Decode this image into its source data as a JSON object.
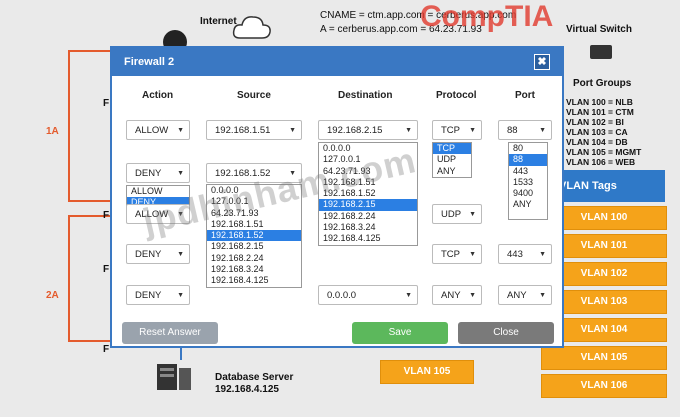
{
  "background": {
    "internet_label": "Internet",
    "cname_line": "CNAME = ctm.app.com = cerberus.app.com",
    "a_record_line": "A = cerberus.app.com = 64.23.71.93",
    "logo_text": "CompTIA",
    "virtual_switch_label": "Virtual Switch",
    "port_groups_label": "Port Groups",
    "vlans": [
      "VLAN 100 = NLB",
      "VLAN 101 = CTM",
      "VLAN 102 = BI",
      "VLAN 103 = CA",
      "VLAN 104 = DB",
      "VLAN 105 = MGMT",
      "VLAN 106 = WEB"
    ],
    "vlan_tags_label": "VLAN Tags",
    "vlan_tags": [
      "VLAN 100",
      "VLAN 101",
      "VLAN 102",
      "VLAN 103",
      "VLAN 104",
      "VLAN 105",
      "VLAN 106"
    ],
    "loose_tag": "VLAN 105",
    "zone_1a": "1A",
    "zone_2a": "2A",
    "f_labels": [
      "F",
      "F",
      "F",
      "F"
    ],
    "db_server_label": "Database Server",
    "db_server_ip": "192.168.4.125",
    "watermark": "jpdhinham.com"
  },
  "dialog": {
    "title": "Firewall 2",
    "close_glyph": "✖",
    "columns": [
      "Action",
      "Source",
      "Destination",
      "Protocol",
      "Port"
    ],
    "rows": [
      {
        "action": "ALLOW",
        "source": "192.168.1.51",
        "destination": "192.168.2.15",
        "protocol": "TCP",
        "port": "88"
      },
      {
        "action": "DENY",
        "source": "192.168.1.52",
        "destination": "",
        "protocol": "",
        "port": ""
      },
      {
        "action": "ALLOW",
        "source": "",
        "destination": "",
        "protocol": "UDP",
        "port": ""
      },
      {
        "action": "DENY",
        "source": "",
        "destination": "",
        "protocol": "TCP",
        "port": "443"
      },
      {
        "action": "DENY",
        "source": "",
        "destination": "0.0.0.0",
        "protocol": "ANY",
        "port": "ANY"
      }
    ],
    "action_options": [
      "ALLOW",
      "DENY"
    ],
    "action_selected": "DENY",
    "ip_options": [
      "0.0.0.0",
      "127.0.0.1",
      "64.23.71.93",
      "192.168.1.51",
      "192.168.1.52",
      "192.168.2.15",
      "192.168.2.24",
      "192.168.3.24",
      "192.168.4.125"
    ],
    "source_selected": "192.168.1.52",
    "destination_selected": "192.168.2.15",
    "protocol_options": [
      "TCP",
      "UDP",
      "ANY"
    ],
    "protocol_selected": "TCP",
    "port_options": [
      "80",
      "88",
      "443",
      "1533",
      "9400",
      "ANY"
    ],
    "port_selected": "88",
    "reset_label": "Reset Answer",
    "save_label": "Save",
    "close_label": "Close",
    "colors": {
      "title_bar": "#3a78c3",
      "highlight": "#2b7fe3",
      "save": "#5cb85c",
      "close": "#7a7a7a",
      "reset": "#9aa3ad",
      "vlan_tag": "#f5a31a"
    }
  }
}
